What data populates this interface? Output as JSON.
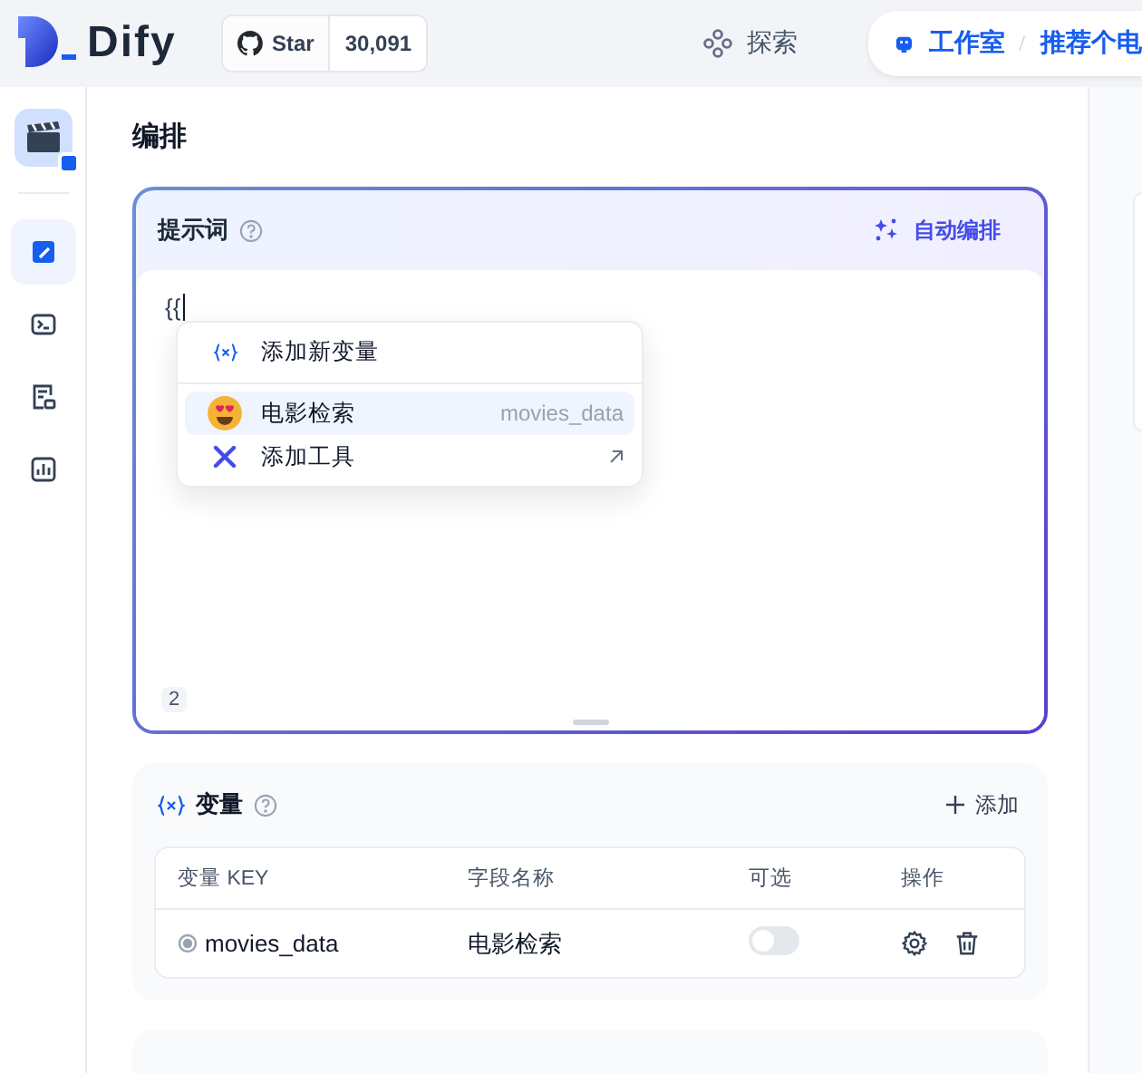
{
  "header": {
    "logo": "Dify",
    "github": {
      "label": "Star",
      "count": "30,091"
    },
    "explore": "探索",
    "breadcrumb": [
      "工作室",
      "推荐个电"
    ]
  },
  "sidebar": {
    "items": [
      {
        "kind": "orchestrate",
        "selected": true
      },
      {
        "kind": "api",
        "selected": false
      },
      {
        "kind": "logs",
        "selected": false
      },
      {
        "kind": "monitor",
        "selected": false
      }
    ]
  },
  "page_title": "编排",
  "prompt": {
    "title": "提示词",
    "auto_button": "自动编排",
    "text": "{{",
    "char_count": "2",
    "menu": {
      "items": [
        {
          "kind": "new-variable",
          "label": "添加新变量",
          "selected": false
        },
        {
          "kind": "variable",
          "label": "电影检索",
          "hint": "movies_data",
          "selected": true
        },
        {
          "kind": "tool",
          "label": "添加工具",
          "selected": false
        }
      ]
    }
  },
  "variables": {
    "title": "变量",
    "add_button": "添加",
    "columns": [
      "变量 KEY",
      "字段名称",
      "可选",
      "操作"
    ],
    "rows": [
      {
        "key": "movies_data",
        "name": "电影检索",
        "optional": false
      }
    ]
  }
}
